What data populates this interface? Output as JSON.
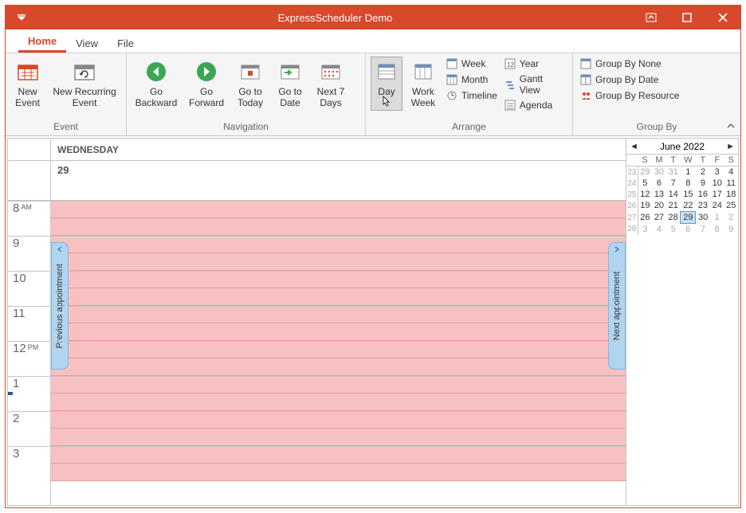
{
  "title": "ExpressScheduler Demo",
  "tabs": {
    "home": "Home",
    "view": "View",
    "file": "File"
  },
  "ribbon": {
    "event": {
      "label": "Event",
      "new_event": "New\nEvent",
      "new_recur": "New Recurring\nEvent"
    },
    "navigation": {
      "label": "Navigation",
      "go_back": "Go\nBackward",
      "go_fwd": "Go\nForward",
      "go_today": "Go to\nToday",
      "go_date": "Go to\nDate",
      "next7": "Next 7\nDays"
    },
    "arrange": {
      "label": "Arrange",
      "day": "Day",
      "work_week": "Work\nWeek",
      "week": "Week",
      "month": "Month",
      "timeline": "Timeline",
      "year": "Year",
      "gantt": "Gantt View",
      "agenda": "Agenda"
    },
    "groupby": {
      "label": "Group By",
      "none": "Group By None",
      "date": "Group By Date",
      "resource": "Group By Resource"
    }
  },
  "scheduler": {
    "day_name": "WEDNESDAY",
    "day_num": "29",
    "prev_appt": "Previous appointment",
    "next_appt": "Next appointment",
    "hours": [
      "8",
      "9",
      "10",
      "11",
      "12",
      "1",
      "2",
      "3"
    ],
    "am": "AM",
    "pm": "PM"
  },
  "minical": {
    "title": "June 2022",
    "dow": [
      "S",
      "M",
      "T",
      "W",
      "T",
      "F",
      "S"
    ],
    "weeks": [
      {
        "wk": "23",
        "d": [
          {
            "v": "29",
            "o": true
          },
          {
            "v": "30",
            "o": true
          },
          {
            "v": "31",
            "o": true
          },
          {
            "v": "1"
          },
          {
            "v": "2"
          },
          {
            "v": "3"
          },
          {
            "v": "4"
          }
        ]
      },
      {
        "wk": "24",
        "d": [
          {
            "v": "5"
          },
          {
            "v": "6"
          },
          {
            "v": "7"
          },
          {
            "v": "8"
          },
          {
            "v": "9"
          },
          {
            "v": "10"
          },
          {
            "v": "11"
          }
        ]
      },
      {
        "wk": "25",
        "d": [
          {
            "v": "12"
          },
          {
            "v": "13"
          },
          {
            "v": "14"
          },
          {
            "v": "15"
          },
          {
            "v": "16"
          },
          {
            "v": "17"
          },
          {
            "v": "18"
          }
        ]
      },
      {
        "wk": "26",
        "d": [
          {
            "v": "19"
          },
          {
            "v": "20"
          },
          {
            "v": "21"
          },
          {
            "v": "22"
          },
          {
            "v": "23"
          },
          {
            "v": "24"
          },
          {
            "v": "25"
          }
        ]
      },
      {
        "wk": "27",
        "d": [
          {
            "v": "26"
          },
          {
            "v": "27"
          },
          {
            "v": "28"
          },
          {
            "v": "29",
            "t": true
          },
          {
            "v": "30"
          },
          {
            "v": "1",
            "o": true
          },
          {
            "v": "2",
            "o": true
          }
        ]
      },
      {
        "wk": "28",
        "d": [
          {
            "v": "3",
            "o": true
          },
          {
            "v": "4",
            "o": true
          },
          {
            "v": "5",
            "o": true
          },
          {
            "v": "6",
            "o": true
          },
          {
            "v": "7",
            "o": true
          },
          {
            "v": "8",
            "o": true
          },
          {
            "v": "9",
            "o": true
          }
        ]
      }
    ]
  }
}
